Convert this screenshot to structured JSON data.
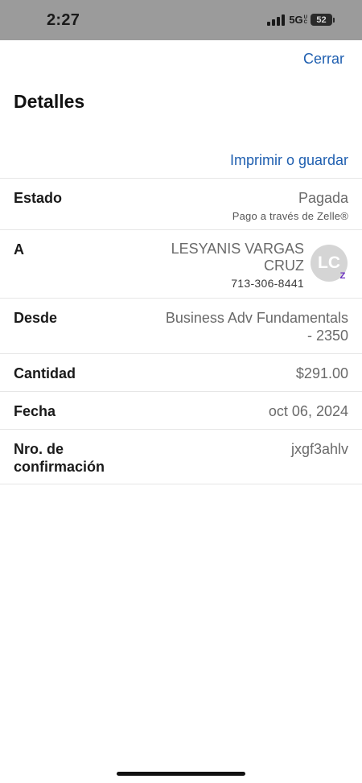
{
  "status_bar": {
    "time": "2:27",
    "network": "5G",
    "network_sub_top": "U",
    "network_sub_bottom": "C",
    "battery": "52"
  },
  "header": {
    "close_label": "Cerrar",
    "title": "Detalles",
    "print_label": "Imprimir o guardar"
  },
  "details": {
    "status": {
      "label": "Estado",
      "value": "Pagada",
      "sub": "Pago a través de Zelle®"
    },
    "recipient": {
      "label": "A",
      "name_line1": "LESYANIS VARGAS",
      "name_line2": "CRUZ",
      "phone": "713-306-8441",
      "initials": "LC",
      "badge": "Z"
    },
    "from": {
      "label": "Desde",
      "value_line1": "Business Adv Fundamentals",
      "value_line2": "- 2350"
    },
    "amount": {
      "label": "Cantidad",
      "value": "$291.00"
    },
    "date": {
      "label": "Fecha",
      "value": "oct 06, 2024"
    },
    "confirmation": {
      "label_line1": "Nro. de",
      "label_line2": "confirmación",
      "value": "jxgf3ahlv"
    }
  }
}
